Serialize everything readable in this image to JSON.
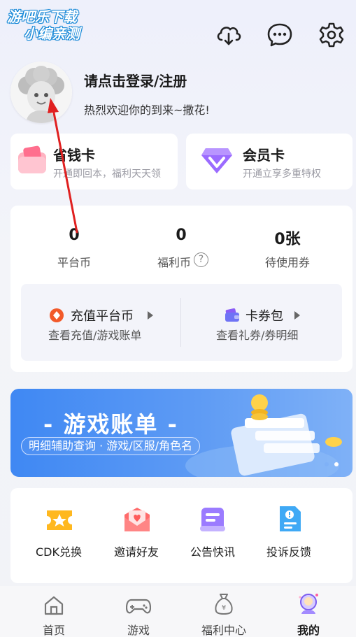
{
  "watermark": {
    "line1": "游吧乐下载",
    "line2": "小编亲测"
  },
  "header_icons": [
    "download-cloud-icon",
    "chat-icon",
    "settings-gear-icon"
  ],
  "profile": {
    "title": "请点击登录/注册",
    "welcome": "热烈欢迎你的到来~撒花!"
  },
  "cards": {
    "save": {
      "title": "省钱卡",
      "sub": "开通即回本，福利天天领"
    },
    "vip": {
      "title": "会员卡",
      "sub": "开通立享多重特权"
    }
  },
  "stats": [
    {
      "value": "0",
      "label": "平台币"
    },
    {
      "value": "0",
      "label": "福利币"
    },
    {
      "value": "0张",
      "label": "待使用券"
    }
  ],
  "help_glyph": "?",
  "actions": {
    "recharge": {
      "title": "充值平台币",
      "sub": "查看充值/游戏账单"
    },
    "wallet": {
      "title": "卡券包",
      "sub": "查看礼券/券明细"
    }
  },
  "banner": {
    "title": "- 游戏账单 -",
    "sub": "明细辅助查询 · 游戏/区服/角色名"
  },
  "tools": [
    {
      "label": "CDK兑换"
    },
    {
      "label": "邀请好友"
    },
    {
      "label": "公告快讯"
    },
    {
      "label": "投诉反馈"
    }
  ],
  "nav": [
    {
      "label": "首页"
    },
    {
      "label": "游戏"
    },
    {
      "label": "福利中心"
    },
    {
      "label": "我的"
    }
  ],
  "colors": {
    "accent_orange": "#f25a2a",
    "purple": "#8a5cf6",
    "banner_blue": "#4a8ff5",
    "annotation_red": "#e02020"
  }
}
